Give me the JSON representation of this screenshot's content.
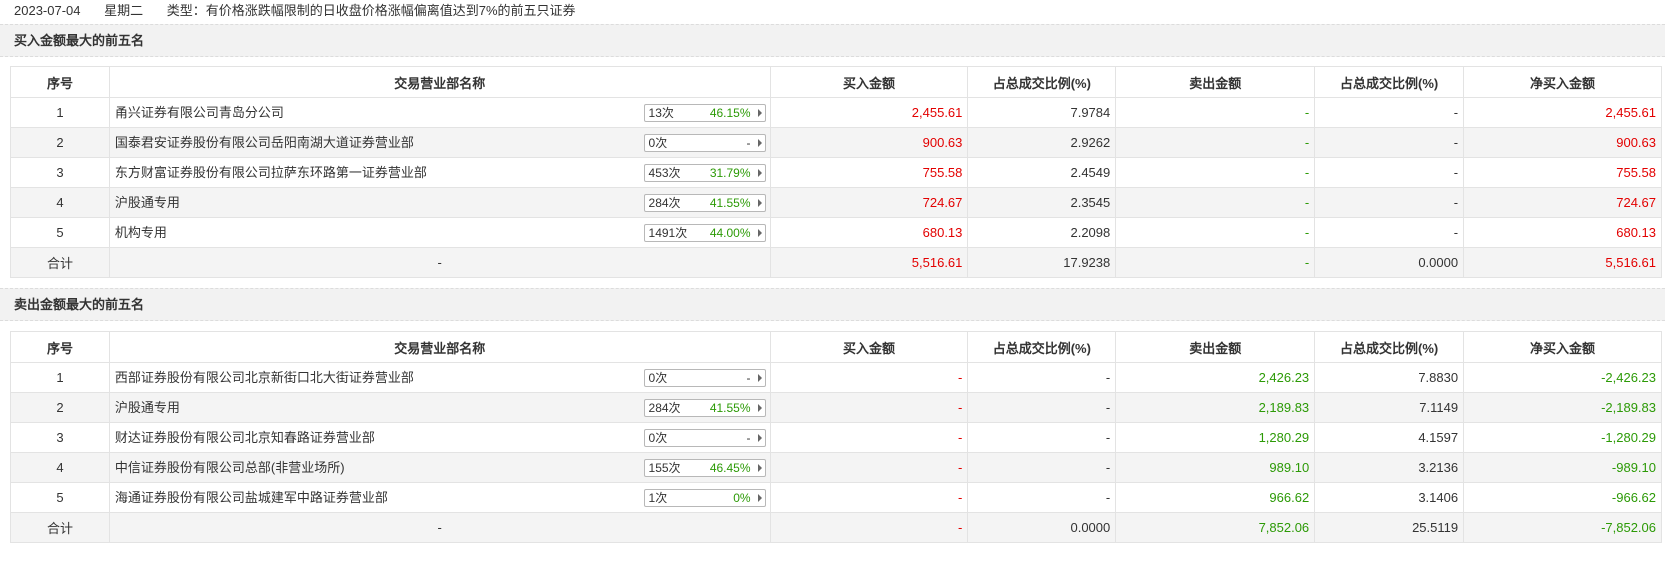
{
  "header": {
    "date": "2023-07-04",
    "weekday": "星期二",
    "type_text": "类型：有价格涨跌幅限制的日收盘价格涨幅偏离值达到7%的前五只证券"
  },
  "columns": [
    "序号",
    "交易营业部名称",
    "买入金额",
    "占总成交比例(%)",
    "卖出金额",
    "占总成交比例(%)",
    "净买入金额"
  ],
  "buy_section": {
    "title": "买入金额最大的前五名",
    "rows": [
      {
        "no": "1",
        "name": "甬兴证券有限公司青岛分公司",
        "times": "13次",
        "rate": "46.15%",
        "buy": "2,455.61",
        "buy_pct": "7.9784",
        "sell": "-",
        "sell_pct": "-",
        "net": "2,455.61"
      },
      {
        "no": "2",
        "name": "国泰君安证券股份有限公司岳阳南湖大道证券营业部",
        "times": "0次",
        "rate": "-",
        "buy": "900.63",
        "buy_pct": "2.9262",
        "sell": "-",
        "sell_pct": "-",
        "net": "900.63"
      },
      {
        "no": "3",
        "name": "东方财富证券股份有限公司拉萨东环路第一证券营业部",
        "times": "453次",
        "rate": "31.79%",
        "buy": "755.58",
        "buy_pct": "2.4549",
        "sell": "-",
        "sell_pct": "-",
        "net": "755.58"
      },
      {
        "no": "4",
        "name": "沪股通专用",
        "times": "284次",
        "rate": "41.55%",
        "buy": "724.67",
        "buy_pct": "2.3545",
        "sell": "-",
        "sell_pct": "-",
        "net": "724.67"
      },
      {
        "no": "5",
        "name": "机构专用",
        "times": "1491次",
        "rate": "44.00%",
        "buy": "680.13",
        "buy_pct": "2.2098",
        "sell": "-",
        "sell_pct": "-",
        "net": "680.13"
      }
    ],
    "total": {
      "label": "合计",
      "name": "-",
      "buy": "5,516.61",
      "buy_pct": "17.9238",
      "sell": "-",
      "sell_pct": "0.0000",
      "net": "5,516.61"
    }
  },
  "sell_section": {
    "title": "卖出金额最大的前五名",
    "rows": [
      {
        "no": "1",
        "name": "西部证券股份有限公司北京新街口北大街证券营业部",
        "times": "0次",
        "rate": "-",
        "buy": "-",
        "buy_pct": "-",
        "sell": "2,426.23",
        "sell_pct": "7.8830",
        "net": "-2,426.23"
      },
      {
        "no": "2",
        "name": "沪股通专用",
        "times": "284次",
        "rate": "41.55%",
        "buy": "-",
        "buy_pct": "-",
        "sell": "2,189.83",
        "sell_pct": "7.1149",
        "net": "-2,189.83"
      },
      {
        "no": "3",
        "name": "财达证券股份有限公司北京知春路证券营业部",
        "times": "0次",
        "rate": "-",
        "buy": "-",
        "buy_pct": "-",
        "sell": "1,280.29",
        "sell_pct": "4.1597",
        "net": "-1,280.29"
      },
      {
        "no": "4",
        "name": "中信证券股份有限公司总部(非营业场所)",
        "times": "155次",
        "rate": "46.45%",
        "buy": "-",
        "buy_pct": "-",
        "sell": "989.10",
        "sell_pct": "3.2136",
        "net": "-989.10"
      },
      {
        "no": "5",
        "name": "海通证券股份有限公司盐城建军中路证券营业部",
        "times": "1次",
        "rate": "0%",
        "buy": "-",
        "buy_pct": "-",
        "sell": "966.62",
        "sell_pct": "3.1406",
        "net": "-966.62"
      }
    ],
    "total": {
      "label": "合计",
      "name": "-",
      "buy": "-",
      "buy_pct": "0.0000",
      "sell": "7,852.06",
      "sell_pct": "25.5119",
      "net": "-7,852.06"
    }
  },
  "colors": {
    "up": "#e30000",
    "down": "#2c9a06",
    "stripe": "#f4f4f4",
    "section_bg": "#f2f2f2"
  }
}
